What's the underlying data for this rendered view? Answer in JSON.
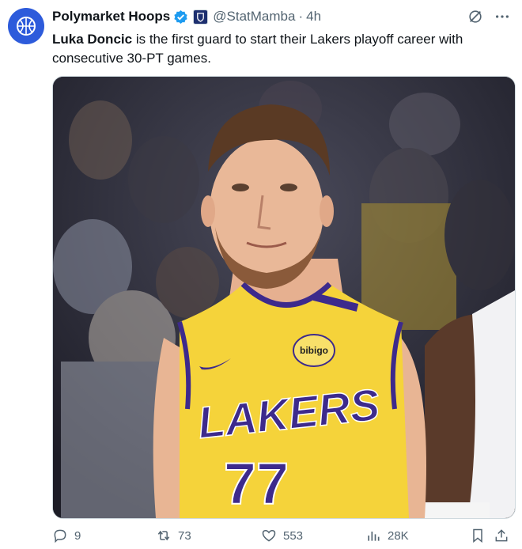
{
  "tweet": {
    "author_name": "Polymarket Hoops",
    "handle": "@StatMamba",
    "separator": "·",
    "time": "4h",
    "text_bold": "Luka Doncic",
    "text_rest": " is the first guard to start their Lakers playoff career with consecutive 30-PT games."
  },
  "media": {
    "jersey_team": "LAKERS",
    "jersey_number": "77",
    "sponsor": "bibigo"
  },
  "actions": {
    "replies": "9",
    "reposts": "73",
    "likes": "553",
    "views": "28K"
  },
  "colors": {
    "brand_blue": "#2d5bdb",
    "verified_blue": "#1d9bf0",
    "lakers_gold": "#f5d33a",
    "lakers_purple": "#3d2a8c"
  }
}
